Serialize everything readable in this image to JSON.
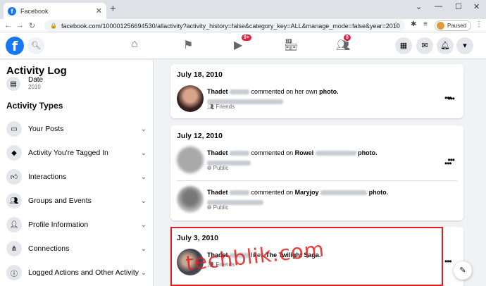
{
  "browser": {
    "tab_title": "Facebook",
    "tab_close": "✕",
    "new_tab": "+",
    "url": "facebook.com/100001256694530/allactivity?activity_history=false&category_key=ALL&manage_mode=false&year=2010",
    "profile_label": "Paused"
  },
  "header": {
    "logo": "f",
    "nav_badges": {
      "watch": "9+",
      "groups": "8"
    }
  },
  "sidebar": {
    "title": "Activity Log",
    "date_filter": {
      "label": "Date",
      "value": "2010"
    },
    "section_title": "Activity Types",
    "items": [
      {
        "label": "Your Posts",
        "icon": "posts-icon"
      },
      {
        "label": "Activity You're Tagged In",
        "icon": "tag-icon"
      },
      {
        "label": "Interactions",
        "icon": "thumbs-up-icon"
      },
      {
        "label": "Groups and Events",
        "icon": "groups-icon"
      },
      {
        "label": "Profile Information",
        "icon": "person-icon"
      },
      {
        "label": "Connections",
        "icon": "connections-icon"
      },
      {
        "label": "Logged Actions and Other Activity",
        "icon": "info-icon"
      }
    ]
  },
  "feed": {
    "groups": [
      {
        "date": "July 18, 2010",
        "entries": [
          {
            "name": "Thadet",
            "action": "commented on her own",
            "object": "photo.",
            "audience": "Friends"
          }
        ]
      },
      {
        "date": "July 12, 2010",
        "entries": [
          {
            "name": "Thadet",
            "action": "commented on",
            "target": "Rowel",
            "object": "photo.",
            "audience": "Public"
          },
          {
            "name": "Thadet",
            "action": "commented on",
            "target": "Maryjoy",
            "object": "photo.",
            "audience": "Public"
          }
        ]
      },
      {
        "date": "July 3, 2010",
        "entries": [
          {
            "name": "Thadet",
            "action": "likes",
            "object": "The Twilight Saga.",
            "audience": "Friends"
          }
        ]
      }
    ]
  },
  "watermark": "techblik.com",
  "colors": {
    "fb_blue": "#1877f2",
    "highlight_red": "#e02020",
    "badge_red": "#e41e3f"
  }
}
